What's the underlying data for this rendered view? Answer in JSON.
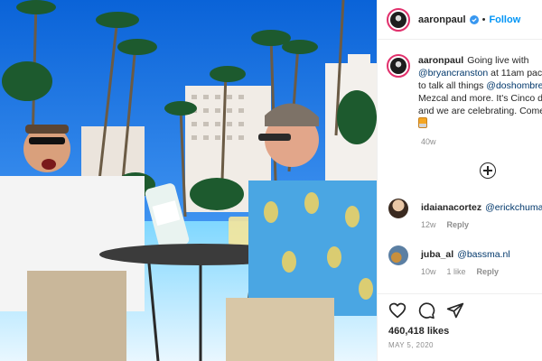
{
  "header": {
    "username": "aaronpaul",
    "separator": "•",
    "follow_label": "Follow"
  },
  "caption": {
    "username": "aaronpaul",
    "lines": [
      {
        "pre": "Going live with",
        "mention": "",
        "post": ""
      },
      {
        "pre": "",
        "mention": "@bryancranston",
        "post": " at 11am pac"
      },
      {
        "pre": "to talk all things ",
        "mention": "@doshombre",
        "post": ""
      },
      {
        "pre": "Mezcal and more. It's Cinco d",
        "mention": "",
        "post": ""
      },
      {
        "pre": "and we are celebrating. Come",
        "mention": "",
        "post": ""
      }
    ],
    "emoji": "tequila-glass-emoji",
    "age": "40w"
  },
  "comments": [
    {
      "username": "idaianacortez",
      "text": "@erickchuman",
      "age": "12w",
      "likes": "",
      "reply_label": "Reply"
    },
    {
      "username": "juba_al",
      "text": "@bassma.nl",
      "age": "10w",
      "likes": "1 like",
      "reply_label": "Reply"
    }
  ],
  "actions": {
    "icons": [
      "heart-icon",
      "comment-icon",
      "share-icon"
    ]
  },
  "likes_text": "460,418 likes",
  "date_text": "MAY 5, 2020",
  "colors": {
    "accent_blue": "#0095f6",
    "mention_blue": "#00376b",
    "muted_gray": "#8e8e8e",
    "text_dark": "#262626",
    "sky_blue": "#1f7fe0"
  }
}
